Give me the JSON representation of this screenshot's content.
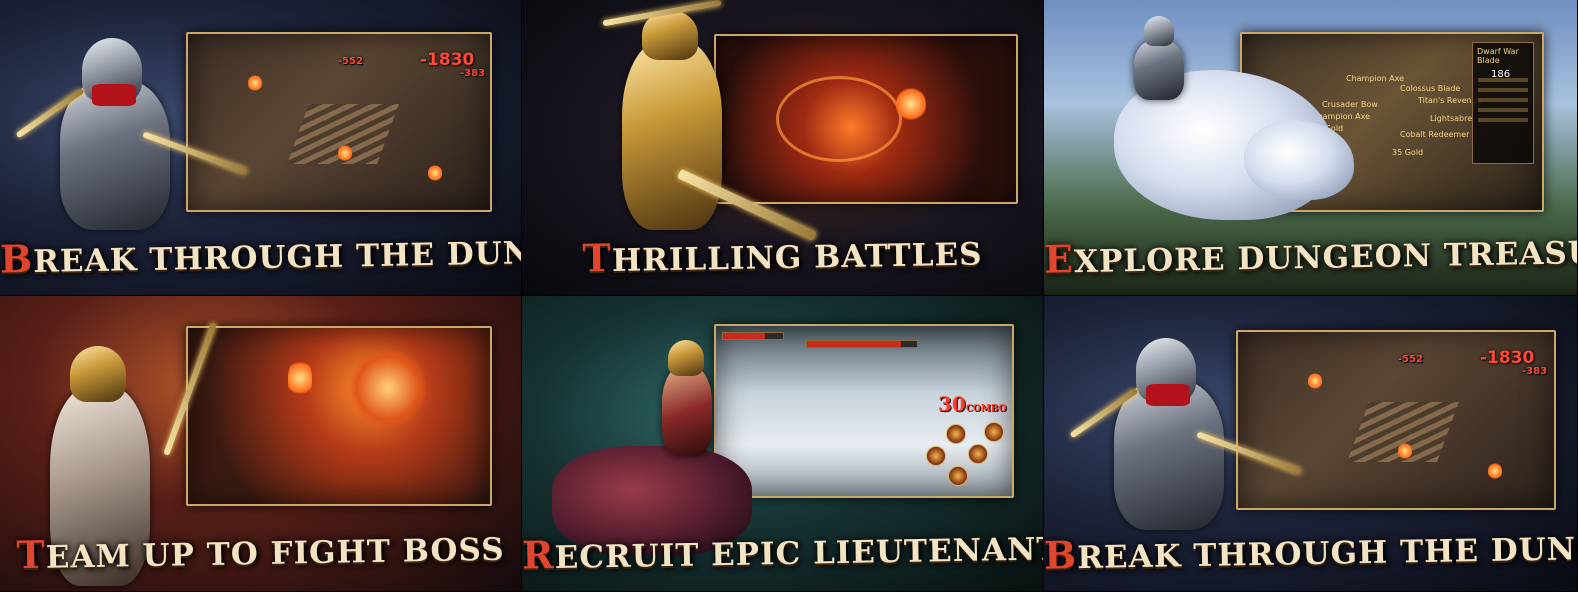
{
  "panels": [
    {
      "caption_first": "B",
      "caption_rest": "REAK THROUGH THE DUNGEON",
      "damage": [
        "-552",
        "-1830",
        "-383"
      ]
    },
    {
      "caption_first": "T",
      "caption_rest": "HRILLING BATTLES"
    },
    {
      "caption_first": "E",
      "caption_rest": "XPLORE DUNGEON TREASURES",
      "loot": [
        "Champion Axe",
        "Colossus Blade",
        "Crusader Bow",
        "Titan's Revenge",
        "Champion Axe",
        "Lightsabre",
        "Cobalt Redeemer",
        "35 Gold",
        "35 Gold"
      ],
      "item_card_title": "Dwarf War Blade",
      "item_card_value": "186"
    },
    {
      "caption_first": "T",
      "caption_rest": "EAM UP TO FIGHT BOSS"
    },
    {
      "caption_first": "R",
      "caption_rest": "ECRUIT EPIC LIEUTENANTS",
      "combo_count": "30",
      "combo_label": "COMBO"
    },
    {
      "caption_first": "B",
      "caption_rest": "REAK THROUGH THE DUNGEON",
      "damage": [
        "-552",
        "-1830",
        "-383"
      ]
    }
  ]
}
